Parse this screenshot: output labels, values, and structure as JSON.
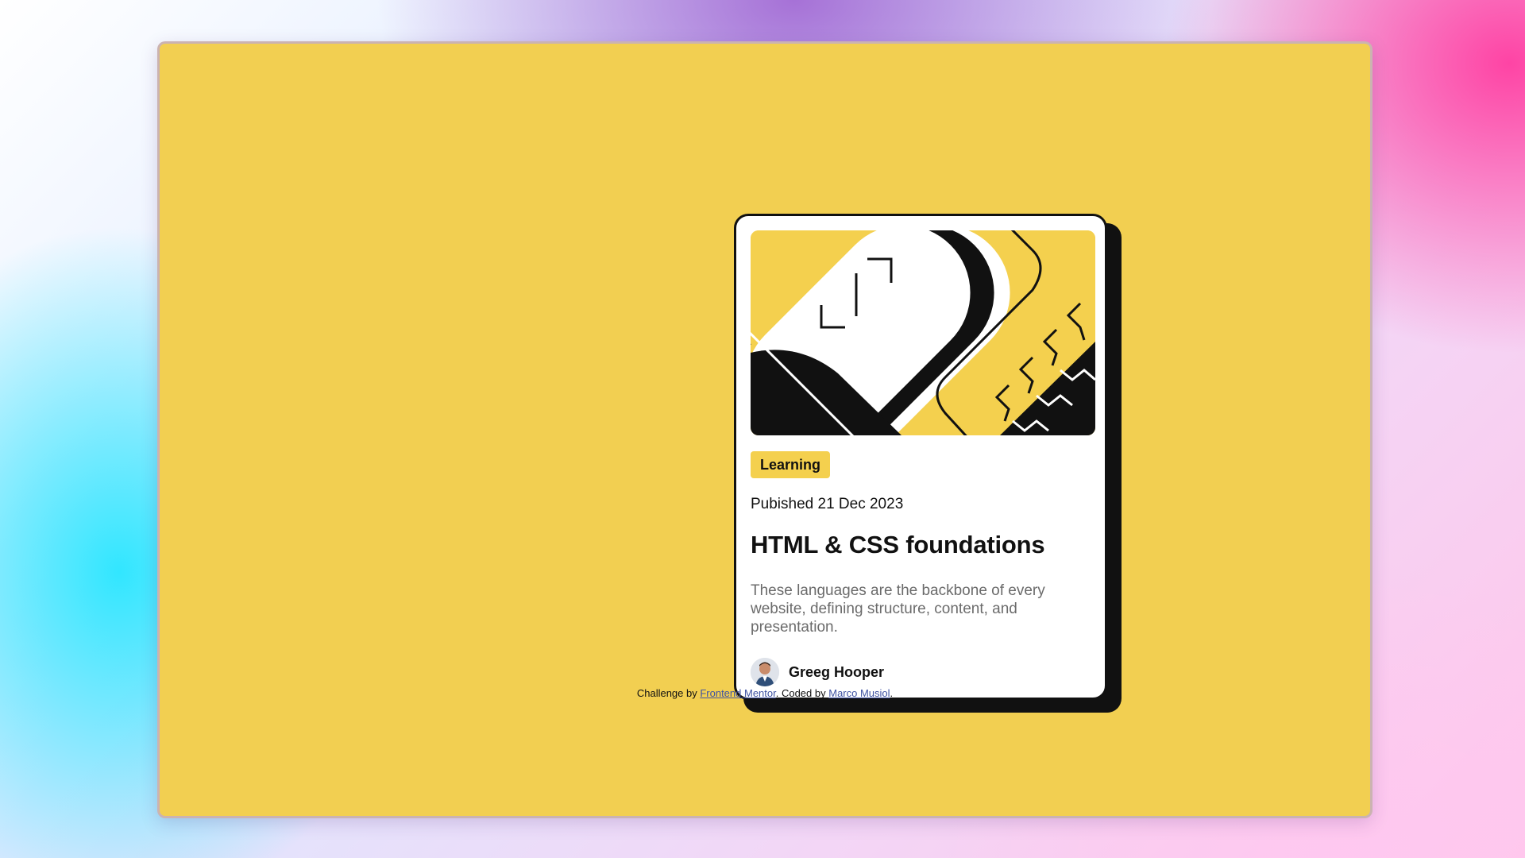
{
  "card": {
    "tag": "Learning",
    "published": "Pubished 21 Dec 2023",
    "title": "HTML & CSS foundations",
    "description": "These languages are the backbone of every website, defining structure, content, and presentation.",
    "author": {
      "name": "Greeg Hooper",
      "avatar_icon": "avatar-photo"
    },
    "hero_icon": "abstract-illustration"
  },
  "attribution": {
    "prefix": "Challenge by ",
    "link1": "Frontend Mentor",
    "middle": ". Coded by ",
    "link2": "Marco Musiol",
    "suffix": "."
  },
  "colors": {
    "page_background": "#f2cf51",
    "card": "#ffffff",
    "ink": "#111111",
    "tag_background": "#f4d04e",
    "link": "#3e52a3",
    "muted_text": "#6b6b6b"
  }
}
